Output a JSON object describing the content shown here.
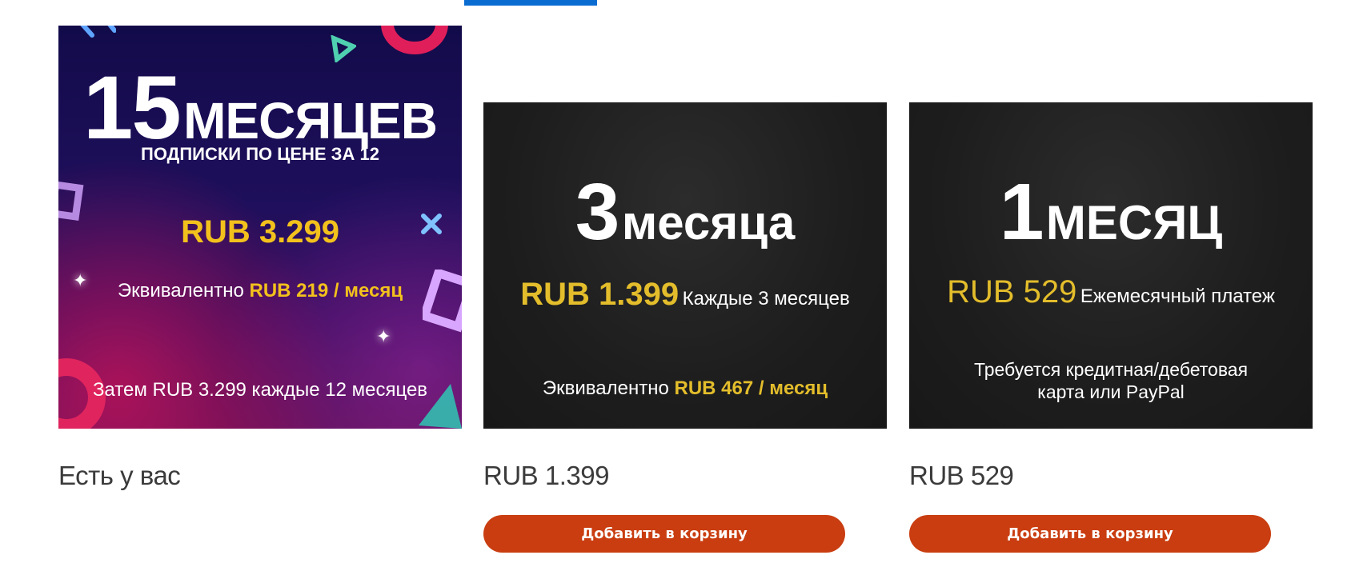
{
  "colors": {
    "accent_tab": "#0a6cd1",
    "button_bg": "#c93d10",
    "price_highlight": "#f3c11c"
  },
  "cards": [
    {
      "promo_big": "15",
      "promo_word": "МЕСЯЦЕВ",
      "promo_sub": "ПОДПИСКИ ПО ЦЕНЕ ЗА 12",
      "promo_price": "RUB 3.299",
      "promo_equiv_prefix": "Эквивалентно",
      "promo_equiv_value": "RUB 219 / месяц",
      "promo_footer": "Затем RUB 3.299 каждые 12 месяцев",
      "price_label": "Есть у вас"
    },
    {
      "promo_big": "3",
      "promo_word": "месяца",
      "promo_price": "RUB 1.399",
      "promo_price_note": "Каждые 3 месяцев",
      "promo_equiv_prefix": "Эквивалентно",
      "promo_equiv_value": "RUB 467 / месяц",
      "price_label": "RUB 1.399",
      "button_label": "Добавить в корзину"
    },
    {
      "promo_big": "1",
      "promo_word": "МЕСЯЦ",
      "promo_price": "RUB 529",
      "promo_price_note": "Ежемесячный платеж",
      "promo_note_line1": "Требуется кредитная/дебетовая",
      "promo_note_line2": "карта или PayPal",
      "price_label": "RUB 529",
      "button_label": "Добавить в корзину"
    }
  ]
}
